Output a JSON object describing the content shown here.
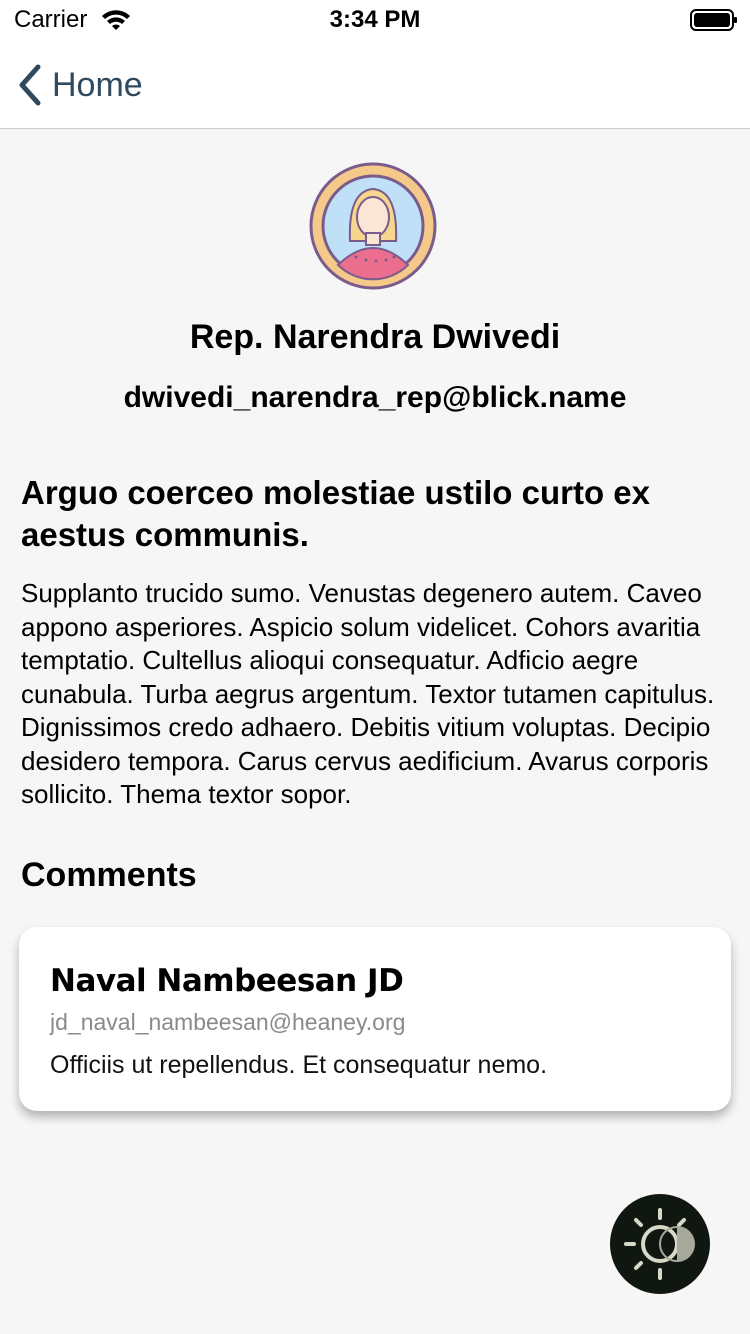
{
  "status_bar": {
    "carrier": "Carrier",
    "time": "3:34 PM",
    "icons": [
      "wifi-icon",
      "battery-icon"
    ]
  },
  "nav": {
    "back_label": "Home",
    "back_icon": "chevron-left-icon"
  },
  "profile": {
    "avatar_icon": "user-avatar-icon",
    "name": "Rep. Narendra Dwivedi",
    "email": "dwivedi_narendra_rep@blick.name"
  },
  "post": {
    "title": "Arguo coerceo molestiae ustilo curto ex aestus communis.",
    "body": "Supplanto trucido sumo. Venustas degenero autem. Caveo appono asperiores. Aspicio solum videlicet. Cohors avaritia temptatio. Cultellus alioqui consequatur. Adficio aegre cunabula. Turba aegrus argentum. Textor tutamen capitulus. Dignissimos credo adhaero. Debitis vitium voluptas. Decipio desidero tempora. Carus cervus aedificium. Avarus corporis sollicito. Thema textor sopor."
  },
  "comments": {
    "heading": "Comments",
    "items": [
      {
        "author": "Naval Nambeesan JD",
        "email": "jd_naval_nambeesan@heaney.org",
        "text": "Officiis ut repellendus. Et consequatur nemo."
      }
    ]
  },
  "theme_toggle": {
    "icon": "theme-toggle-icon"
  },
  "colors": {
    "background": "#f6f6f6",
    "nav_text": "#2f4a5f",
    "card_bg": "#ffffff",
    "secondary_text": "#8a8a8a",
    "toggle_bg": "#101610"
  }
}
